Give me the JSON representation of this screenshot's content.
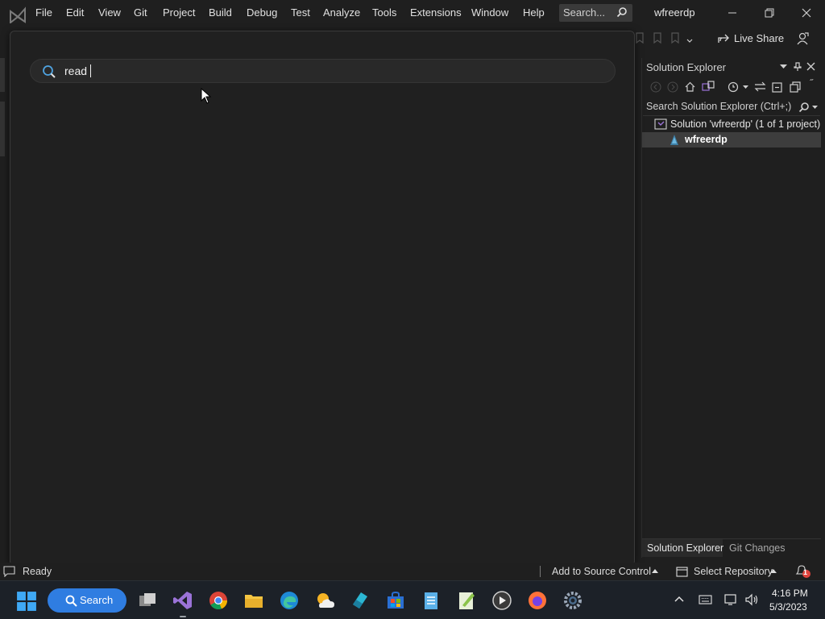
{
  "menu": [
    "File",
    "Edit",
    "View",
    "Git",
    "Project",
    "Build",
    "Debug",
    "Test",
    "Analyze",
    "Tools",
    "Extensions",
    "Window",
    "Help"
  ],
  "search_placeholder": "Search...",
  "window_title": "wfreerdp",
  "toolbar": {
    "live_share": "Live Share"
  },
  "quick_search": {
    "query": "read"
  },
  "solution_explorer": {
    "title": "Solution Explorer",
    "search_placeholder": "Search Solution Explorer (Ctrl+;)",
    "solution_label": "Solution 'wfreerdp' (1 of 1 project)",
    "project_label": "wfreerdp",
    "tabs": [
      "Solution Explorer",
      "Git Changes"
    ]
  },
  "statusbar": {
    "ready": "Ready",
    "add_source_control": "Add to Source Control",
    "select_repository": "Select Repository",
    "notification_count": "1"
  },
  "taskbar": {
    "search_label": "Search",
    "time": "4:16 PM",
    "date": "5/3/2023"
  },
  "colors": {
    "accent": "#2f7de1",
    "vs_purple": "#9b73d8",
    "notification": "#e0443e"
  }
}
